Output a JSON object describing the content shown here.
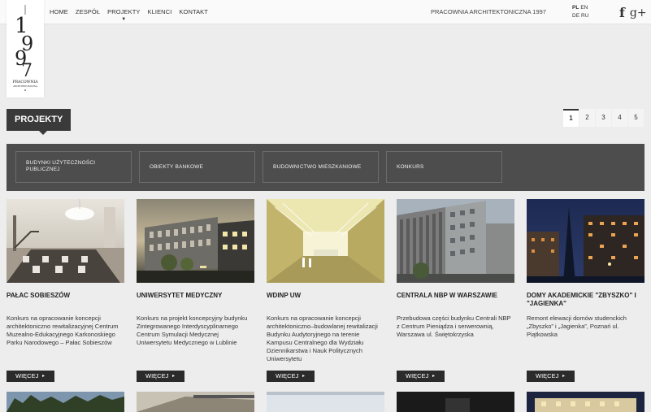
{
  "logo": {
    "digits": [
      "1",
      "9",
      "9",
      "7"
    ],
    "wordmark": "PRACOWNIA",
    "submark": "ARCHITEKTONICZNA"
  },
  "nav": {
    "items": [
      "HOME",
      "ZESPÓŁ",
      "PROJEKTY",
      "KLIENCI",
      "KONTAKT"
    ]
  },
  "tagline": "PRACOWNIA ARCHITEKTONICZNA 1997",
  "langs": {
    "pl": "PL",
    "en": "EN",
    "de": "DE",
    "ru": "RU"
  },
  "social": {
    "facebook": "f",
    "google": "g+"
  },
  "section_title": "PROJEKTY",
  "pager": [
    "1",
    "2",
    "3",
    "4",
    "5"
  ],
  "categories": [
    {
      "line1": "BUDYNKI UŻYTECZNOŚCI",
      "line2": "PUBLICZNEJ"
    },
    {
      "line1": "OBIEKTY BANKOWE",
      "line2": ""
    },
    {
      "line1": "BUDOWNICTWO MIESZKANIOWE",
      "line2": ""
    },
    {
      "line1": "KONKURS",
      "line2": ""
    }
  ],
  "projects": [
    {
      "title": "PAŁAC SOBIESZÓW",
      "desc": "Konkurs na opracowanie koncepcji architektoniczno rewitalizacyjnej Centrum Muzealno-Edukacyjnego Karkonoskiego Parku Narodowego – Pałac Sobieszów"
    },
    {
      "title": "UNIWERSYTET MEDYCZNY",
      "desc": "Konkurs na projekt koncepcyjny budynku Zintegrowanego Interdyscyplinarnego Centrum Symulacji Medycznej Uniwersytetu Medycznego w Lublinie"
    },
    {
      "title": "WDINP UW",
      "desc": "Konkurs na opracowanie koncepcji architektoniczno–budowlanej rewitalizacji Budynku Audytoryjnego na terenie Kampusu Centralnego dla Wydziału Dziennikarstwa i Nauk Politycznych Uniwersytetu"
    },
    {
      "title": "CENTRALA NBP W WARSZAWIE",
      "desc": "Przebudowa części budynku Centrali NBP z Centrum Pieniądza i serwerownią, Warszawa ul. Świętokrzyska"
    },
    {
      "title": "DOMY AKADEMICKIE \"ZBYSZKO\" I \"JAGIENKA\"",
      "desc": "Remont elewacji domów studenckich „Zbyszko” i „Jagienka”, Poznań ul. Piątkowska"
    }
  ],
  "more_label": "WIĘCEJ",
  "colors": {
    "dark": "#3a3a3a",
    "catbar": "#4d4d4d",
    "button": "#2b2b2b",
    "background": "#ededed"
  }
}
